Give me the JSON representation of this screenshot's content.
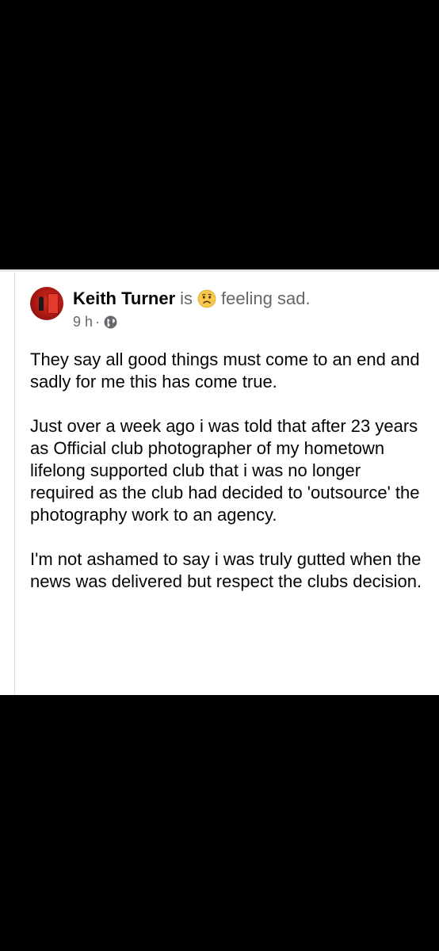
{
  "post": {
    "author": "Keith Turner",
    "is_word": "is",
    "feeling_emoji": "sad-face-emoji",
    "feeling": "feeling sad.",
    "time": "9 h",
    "separator": "·",
    "audience_icon": "globe-icon",
    "paragraphs": [
      "They say all good things must come to an end and sadly for me this has come true.",
      "Just over a week ago i was told that after 23 years as Official club photographer of my hometown lifelong supported club that i was no longer required as the club had decided to 'outsource' the photography work to an agency.",
      "I'm not ashamed to say i was truly gutted when the news was delivered but respect the clubs decision."
    ]
  },
  "colors": {
    "background": "#000000",
    "card": "#ffffff",
    "name": "#050505",
    "secondary_text": "#65676b",
    "emoji_face": "#f7c84b"
  }
}
